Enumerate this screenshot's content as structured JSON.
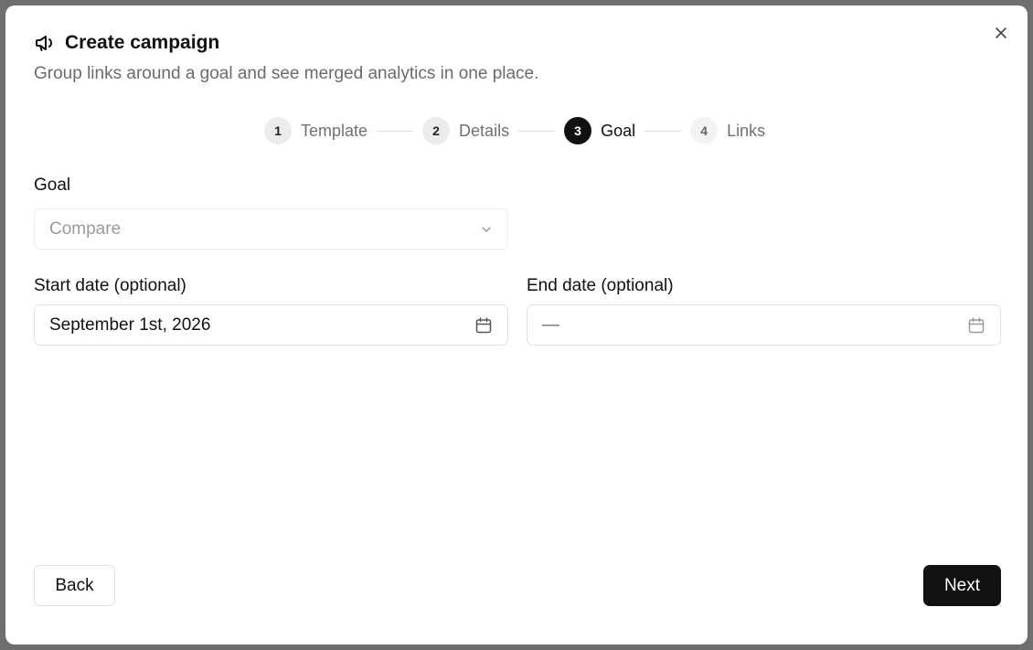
{
  "dialog": {
    "title": "Create campaign",
    "subtitle": "Group links around a goal and see merged analytics in one place.",
    "icon": "megaphone-icon",
    "close_icon": "close-icon"
  },
  "steps": [
    {
      "number": "1",
      "label": "Template",
      "state": "done"
    },
    {
      "number": "2",
      "label": "Details",
      "state": "done"
    },
    {
      "number": "3",
      "label": "Goal",
      "state": "active"
    },
    {
      "number": "4",
      "label": "Links",
      "state": "upcoming"
    }
  ],
  "goal": {
    "label": "Goal",
    "value": "Compare",
    "icon": "chevron-down-icon"
  },
  "start_date": {
    "label": "Start date (optional)",
    "value": "September 1st, 2026",
    "icon": "calendar-icon"
  },
  "end_date": {
    "label": "End date (optional)",
    "value": "—",
    "icon": "calendar-icon"
  },
  "actions": {
    "back_label": "Back",
    "next_label": "Next"
  },
  "colors": {
    "primary": "#111111",
    "muted_text": "#6b6b6b",
    "border": "#e2e2e2",
    "backdrop": "#6f6f6f"
  }
}
